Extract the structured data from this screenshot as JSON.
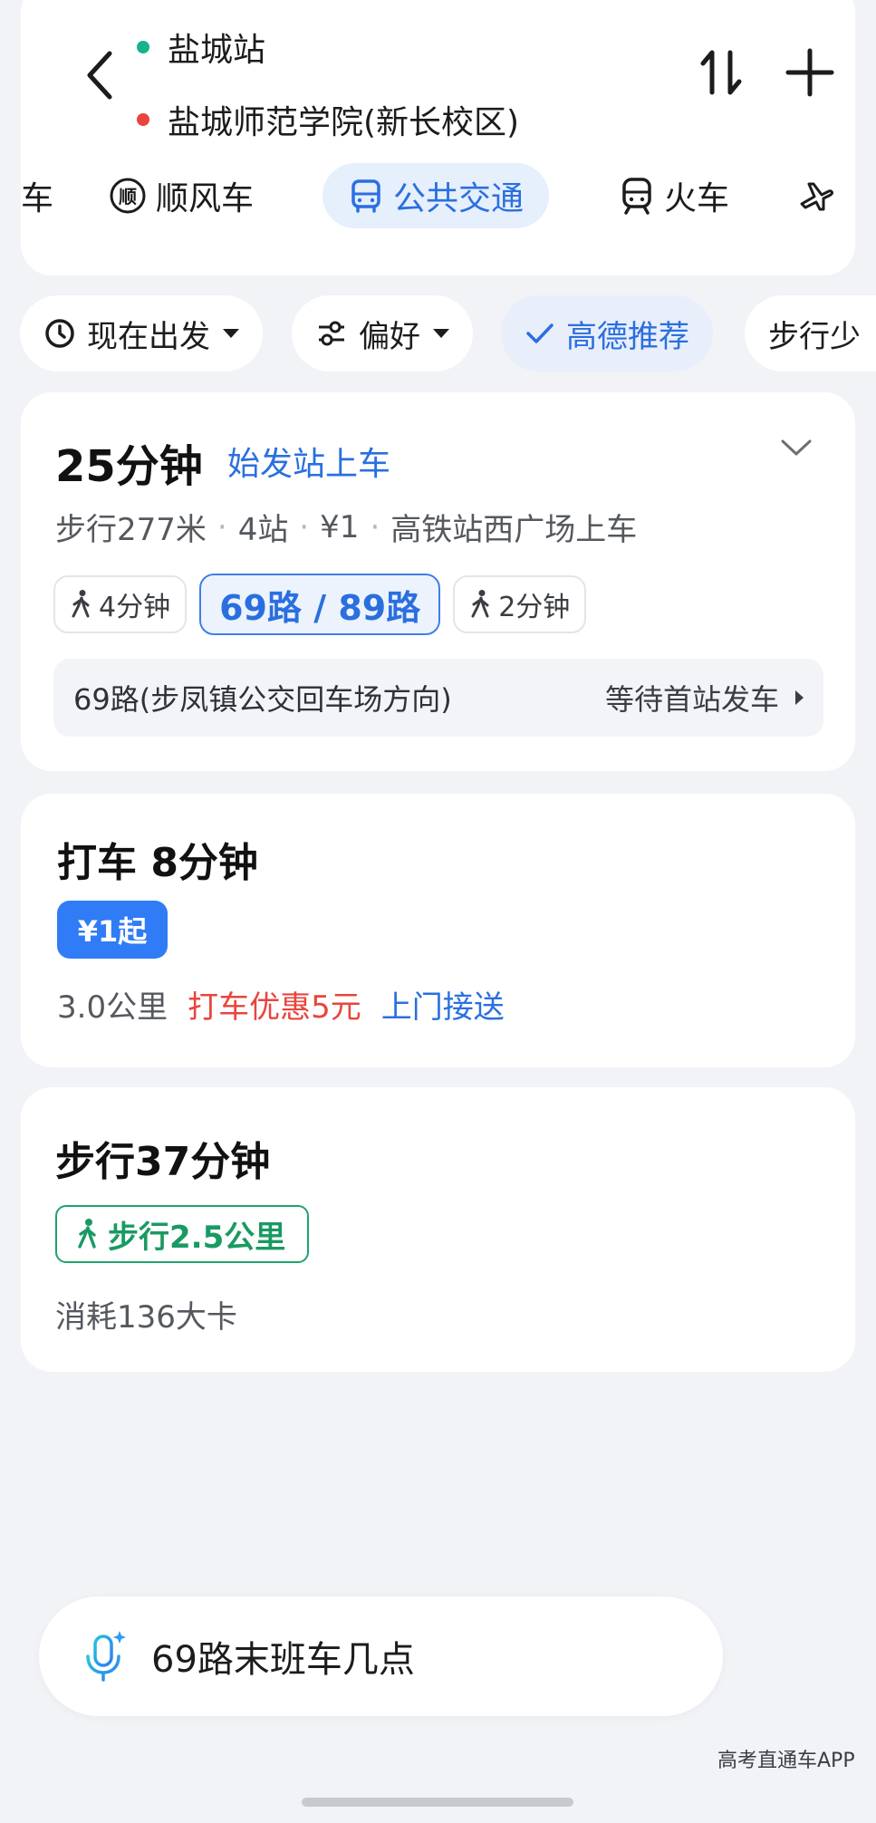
{
  "header": {
    "origin": "盐城站",
    "destination": "盐城师范学院(新长校区)",
    "origin_dot_color": "#18b38a",
    "destination_dot_color": "#e8453c",
    "mode_tabs": [
      {
        "label": "车",
        "icon": "car-icon"
      },
      {
        "label": "顺风车",
        "icon": "carpool-icon",
        "icon_text": "顺"
      },
      {
        "label": "公共交通",
        "icon": "bus-icon",
        "active": true
      },
      {
        "label": "火车",
        "icon": "train-icon"
      },
      {
        "label": "",
        "icon": "plane-icon"
      }
    ]
  },
  "filters": [
    {
      "label": "现在出发",
      "icon": "clock-icon"
    },
    {
      "label": "偏好",
      "icon": "sliders-icon"
    },
    {
      "label": "高德推荐",
      "icon": "check-icon",
      "active": true
    },
    {
      "label": "步行少"
    }
  ],
  "bus_route": {
    "duration": "25分钟",
    "badge": "始发站上车",
    "walk_distance": "步行277米",
    "stops": "4站",
    "price": "¥1",
    "boarding": "高铁站西广场上车",
    "walk_before": "4分钟",
    "lines": "69路 / 89路",
    "walk_after": "2分钟",
    "line_direction": "69路(步凤镇公交回车场方向)",
    "status": "等待首站发车"
  },
  "taxi": {
    "title": "打车 8分钟",
    "price_badge": "¥1起",
    "distance": "3.0公里",
    "promo": "打车优惠5元",
    "pickup": "上门接送"
  },
  "walk": {
    "title": "步行37分钟",
    "badge": "步行2.5公里",
    "calories": "消耗136大卡"
  },
  "voice": {
    "query": "69路末班车几点"
  },
  "watermark": "高考直通车APP",
  "colors": {
    "accent": "#2a6fe0",
    "promo_red": "#e8453c",
    "walk_green": "#1a9a63",
    "background": "#f1f3f6"
  }
}
